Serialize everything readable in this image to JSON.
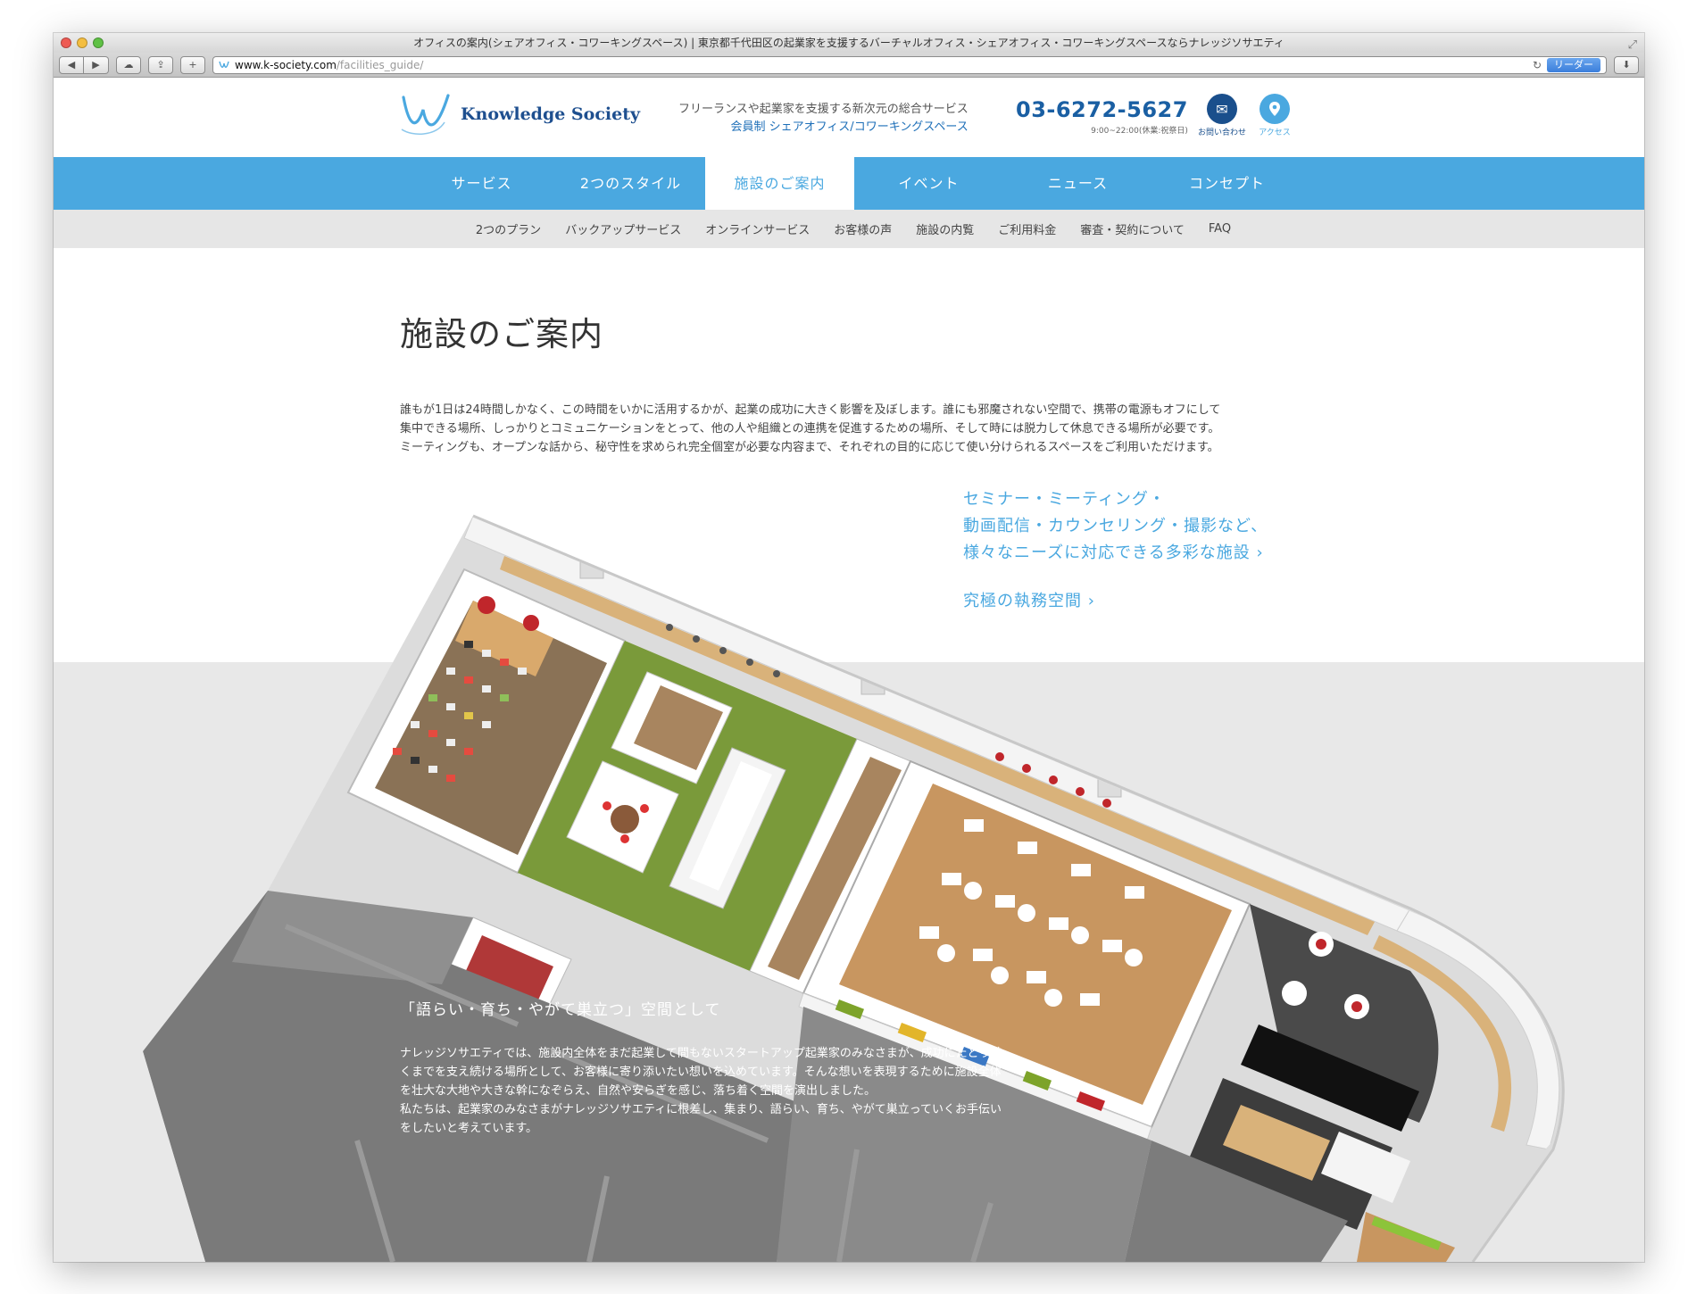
{
  "browser": {
    "window_title": "オフィスの案内(シェアオフィス・コワーキングスペース) | 東京都千代田区の起業家を支援するバーチャルオフィス・シェアオフィス・コワーキングスペースならナレッジソサエティ",
    "url_host": "www.k-society.com",
    "url_path": "/facilities_guide/",
    "reader_label": "リーダー"
  },
  "header": {
    "logo_text": "Knowledge Society",
    "tagline_line1": "フリーランスや起業家を支援する新次元の総合サービス",
    "tagline_line2": "会員制 シェアオフィス/コワーキングスペース",
    "phone": "03-6272-5627",
    "hours": "9:00~22:00(休業:祝祭日)",
    "contact_label": "お問い合わせ",
    "access_label": "アクセス",
    "brand_color": "#4aa8e0"
  },
  "nav": {
    "items": [
      {
        "label": "サービス"
      },
      {
        "label": "2つのスタイル"
      },
      {
        "label": "施設のご案内"
      },
      {
        "label": "イベント"
      },
      {
        "label": "ニュース"
      },
      {
        "label": "コンセプト"
      }
    ],
    "active_index": 2
  },
  "subnav": {
    "items": [
      {
        "label": "2つのプラン"
      },
      {
        "label": "バックアップサービス"
      },
      {
        "label": "オンラインサービス"
      },
      {
        "label": "お客様の声"
      },
      {
        "label": "施設の内覧"
      },
      {
        "label": "ご利用料金"
      },
      {
        "label": "審査・契約について"
      },
      {
        "label": "FAQ"
      }
    ]
  },
  "main": {
    "title": "施設のご案内",
    "intro_lines": [
      "誰もが1日は24時間しかなく、この時間をいかに活用するかが、起業の成功に大きく影響を及ぼします。誰にも邪魔されない空間で、携帯の電源もオフにして",
      "集中できる場所、しっかりとコミュニケーションをとって、他の人や組織との連携を促進するための場所、そして時には脱力して休息できる場所が必要です。",
      "ミーティングも、オープンな話から、秘守性を求められ完全個室が必要な内容まで、それぞれの目的に応じて使い分けられるスペースをご利用いただけます。"
    ],
    "link1_lines": [
      "セミナー・ミーティング・",
      "動画配信・カウンセリング・撮影など、",
      "様々なニーズに対応できる多彩な施設 ›"
    ],
    "link2": "究極の執務空間 ›",
    "overlay_heading": "「語らい・育ち・やがて巣立つ」空間として",
    "overlay_lines": [
      "ナレッジソサエティでは、施設内全体をまだ起業して間もないスタートアップ起業家のみなさまが、成功にたどり着",
      "くまでを支え続ける場所として、お客様に寄り添いたい想いを込めています。そんな想いを表現するために施設全体",
      "を壮大な大地や大きな幹になぞらえ、自然や安らぎを感じ、落ち着く空間を演出しました。",
      "私たちは、起業家のみなさまがナレッジソサエティに根差し、集まり、語らい、育ち、やがて巣立っていくお手伝い",
      "をしたいと考えています。"
    ]
  }
}
